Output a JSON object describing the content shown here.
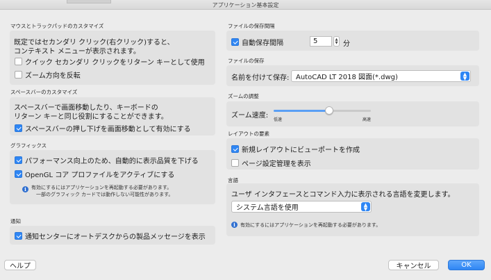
{
  "window": {
    "title": "アプリケーション基本設定"
  },
  "trackpad": {
    "header": "マウスとトラックパッドのカスタマイズ",
    "description_line1": "既定ではセカンダリ クリック(右クリック)すると、",
    "description_line2": "コンテキスト メニューが表示されます。",
    "secondary_click_label": "クイック セカンダリ クリックをリターン キーとして使用",
    "secondary_click_checked": false,
    "reverse_zoom_label": "ズーム方向を反転",
    "reverse_zoom_checked": false
  },
  "spacebar": {
    "header": "スペースバーのカスタマイズ",
    "description_line1": "スペースバーで画面移動したり、キーボードの",
    "description_line2": "リターン キーと同じ役割にすることができます。",
    "pan_label": "スペースバーの押し下げを画面移動として有効にする",
    "pan_checked": true
  },
  "graphics": {
    "header": "グラフィックス",
    "auto_quality_label": "パフォーマンス向上のため、自動的に表示品質を下げる",
    "auto_quality_checked": true,
    "opengl_label": "OpenGL コア プロファイルをアクティブにする",
    "opengl_checked": true,
    "note_line1": "有効にするにはアプリケーションを再起動する必要があります。",
    "note_line2": "一部のグラフィック カードでは動作しない可能性があります。"
  },
  "notifications": {
    "header": "通知",
    "label": "通知センターにオートデスクからの製品メッセージを表示",
    "checked": true
  },
  "autosave": {
    "header": "ファイルの保存間隔",
    "label": "自動保存間隔",
    "checked": true,
    "value": "5",
    "unit": "分"
  },
  "filesave": {
    "header": "ファイルの保存",
    "label": "名前を付けて保存:",
    "selected": "AutoCAD LT 2018 図面(*.dwg)"
  },
  "zoom": {
    "header": "ズームの調整",
    "label": "ズーム速度:",
    "low_label": "低速",
    "high_label": "高速",
    "value_fraction": 0.57
  },
  "layout": {
    "header": "レイアウトの要素",
    "viewport_label": "新規レイアウトにビューポートを作成",
    "viewport_checked": true,
    "pagesetup_label": "ページ設定管理を表示",
    "pagesetup_checked": false
  },
  "language": {
    "header": "言語",
    "description": "ユーザ インタフェースとコマンド入力に表示される言語を変更します。",
    "selected": "システム言語を使用",
    "note": "有効にするにはアプリケーションを再起動する必要があります。"
  },
  "footer": {
    "help_label": "ヘルプ",
    "cancel_label": "キャンセル",
    "ok_label": "OK"
  },
  "colors": {
    "accent": "#2f86f4",
    "background": "#ececec",
    "group_box": "#e2e2e2"
  }
}
